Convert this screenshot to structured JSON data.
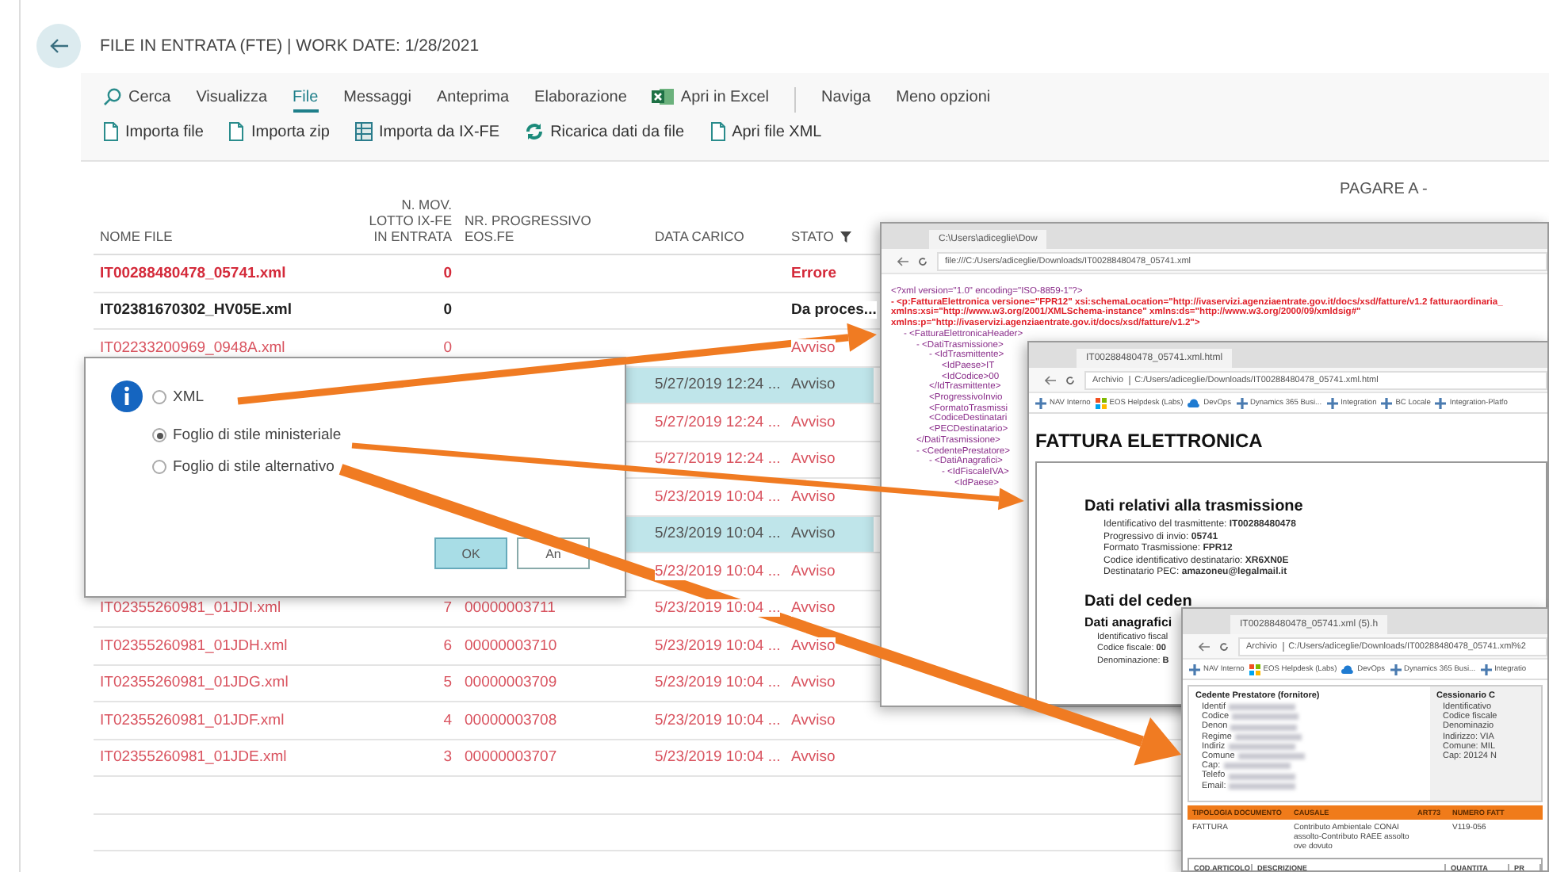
{
  "page": {
    "title": "FILE IN ENTRATA (FTE) | WORK DATE: 1/28/2021"
  },
  "menu": [
    {
      "label": "Cerca",
      "kind": "search",
      "selected": false
    },
    {
      "label": "Visualizza",
      "selected": false
    },
    {
      "label": "File",
      "selected": true
    },
    {
      "label": "Messaggi",
      "selected": false
    },
    {
      "label": "Anteprima",
      "selected": false
    },
    {
      "label": "Elaborazione",
      "selected": false
    },
    {
      "label": "Apri in Excel",
      "kind": "excel",
      "selected": false
    }
  ],
  "menu_more": [
    {
      "label": "Naviga",
      "selected": false
    },
    {
      "label": "Meno opzioni",
      "selected": false
    }
  ],
  "actions": [
    {
      "label": "Importa file",
      "kind": "document"
    },
    {
      "label": "Importa zip",
      "kind": "document"
    },
    {
      "label": "Importa da IX-FE",
      "kind": "table"
    },
    {
      "label": "Ricarica dati da file",
      "kind": "refresh"
    },
    {
      "label": "Apri file XML",
      "kind": "document"
    }
  ],
  "table": {
    "columns": [
      {
        "lines": [
          "NOME FILE"
        ]
      },
      {
        "lines": [
          "N. MOV.",
          "LOTTO IX-FE",
          "IN ENTRATA"
        ]
      },
      {
        "lines": [
          "NR. PROGRESSIVO",
          "EOS.FE"
        ]
      },
      {
        "lines": [
          "DATA CARICO"
        ]
      },
      {
        "lines": [
          "STATO"
        ],
        "filtered": true
      }
    ],
    "extra_column": "PAGARE A -",
    "rows": [
      {
        "name": "IT00288480478_05741.xml",
        "count": "0",
        "status": "Errore",
        "kind": "error",
        "selected": false
      },
      {
        "name": "IT02381670302_HV05E.xml",
        "count": "0",
        "status": "Da proces...",
        "kind": "pending",
        "selected": false
      },
      {
        "name": "IT02233200969_0948A.xml",
        "count": "0",
        "status": "Avviso",
        "kind": "warning",
        "selected": false
      },
      {
        "date": "5/27/2019 12:24 ...",
        "status": "Avviso",
        "kind": "warning",
        "selected": true
      },
      {
        "date": "5/27/2019 12:24 ...",
        "status": "Avviso",
        "kind": "warning",
        "selected": false
      },
      {
        "date": "5/27/2019 12:24 ...",
        "status": "Avviso",
        "kind": "warning",
        "selected": false
      },
      {
        "date": "5/23/2019 10:04 ...",
        "status": "Avviso",
        "kind": "warning",
        "selected": false
      },
      {
        "date": "5/23/2019 10:04 ...",
        "status": "Avviso",
        "kind": "warning",
        "selected": true
      },
      {
        "date": "5/23/2019 10:04 ...",
        "status": "Avviso",
        "kind": "warning",
        "selected": false
      },
      {
        "name": "IT02355260981_01JDI.xml",
        "count": "7",
        "progressive": "00000003711",
        "date": "5/23/2019 10:04 ...",
        "status": "Avviso",
        "kind": "warning",
        "selected": false
      },
      {
        "name": "IT02355260981_01JDH.xml",
        "count": "6",
        "progressive": "00000003710",
        "date": "5/23/2019 10:04 ...",
        "status": "Avviso",
        "kind": "warning",
        "selected": false
      },
      {
        "name": "IT02355260981_01JDG.xml",
        "count": "5",
        "progressive": "00000003709",
        "date": "5/23/2019 10:04 ...",
        "status": "Avviso",
        "kind": "warning",
        "selected": false
      },
      {
        "name": "IT02355260981_01JDF.xml",
        "count": "4",
        "progressive": "00000003708",
        "date": "5/23/2019 10:04 ...",
        "status": "Avviso",
        "kind": "warning",
        "selected": false
      },
      {
        "name": "IT02355260981_01JDE.xml",
        "count": "3",
        "progressive": "00000003707",
        "date": "5/23/2019 10:04 ...",
        "status": "Avviso",
        "kind": "warning",
        "selected": false
      }
    ]
  },
  "dialog": {
    "options": [
      {
        "label": "XML",
        "selected": false
      },
      {
        "label": "Foglio di stile ministeriale",
        "selected": true
      },
      {
        "label": "Foglio di stile alternativo",
        "selected": false
      }
    ],
    "buttons": [
      {
        "label": "OK",
        "kind": "primary"
      },
      {
        "label": "An",
        "kind": "secondary"
      }
    ]
  },
  "xml_viewer": {
    "tab": "C:\\Users\\adiceglie\\Dow",
    "address": "file:///C:/Users/adiceglie/Downloads/IT00288480478_05741.xml",
    "lines": [
      {
        "text": "<?xml version=\"1.0\" encoding=\"ISO-8859-1\"?>",
        "kind": "decl"
      },
      {
        "text": "- <p:FatturaElettronica versione=\"FPR12\" xsi:schemaLocation=\"http://ivaservizi.agenziaentrate.gov.it/docs/xsd/fatture/v1.2 fatturaordinaria_",
        "kind": "attr"
      },
      {
        "text": "xmlns:xsi=\"http://www.w3.org/2001/XMLSchema-instance\" xmlns:ds=\"http://www.w3.org/2000/09/xmldsig#\"",
        "kind": "attr"
      },
      {
        "text": "xmlns:p=\"http://ivaservizi.agenziaentrate.gov.it/docs/xsd/fatture/v1.2\">",
        "kind": "attr",
        "children": [
          {
            "text": "- <FatturaElettronicaHeader>",
            "kind": "tag",
            "children": [
              {
                "text": "- <DatiTrasmissione>",
                "kind": "tag",
                "children": [
                  {
                    "text": "- <IdTrasmittente>",
                    "kind": "tag",
                    "children": [
                      {
                        "text": "<IdPaese>IT",
                        "kind": "tag"
                      },
                      {
                        "text": "<IdCodice>00",
                        "kind": "tag"
                      }
                    ]
                  },
                  {
                    "text": "</IdTrasmittente>",
                    "kind": "tag"
                  },
                  {
                    "text": "<ProgressivoInvio",
                    "kind": "tag"
                  },
                  {
                    "text": "<FormatoTrasmissi",
                    "kind": "tag"
                  },
                  {
                    "text": "<CodiceDestinatari",
                    "kind": "tag"
                  },
                  {
                    "text": "<PECDestinatario>",
                    "kind": "tag"
                  }
                ]
              },
              {
                "text": "</DatiTrasmissione>",
                "kind": "tag"
              },
              {
                "text": "- <CedentePrestatore>",
                "kind": "tag",
                "children": [
                  {
                    "text": "- <DatiAnagrafici>",
                    "kind": "tag",
                    "children": [
                      {
                        "text": "- <IdFiscaleIVA>",
                        "kind": "tag",
                        "children": [
                          {
                            "text": "<IdPaese>",
                            "kind": "tag"
                          }
                        ]
                      }
                    ]
                  }
                ]
              }
            ]
          }
        ]
      }
    ]
  },
  "html_viewer": {
    "tab": "IT00288480478_05741.xml.html",
    "address_label": "Archivio",
    "address": "C:/Users/adiceglie/Downloads/IT00288480478_05741.xml.html",
    "bookmarks": [
      {
        "label": "NAV Interno",
        "kind": "plus"
      },
      {
        "label": "EOS Helpdesk (Labs)",
        "kind": "tiles"
      },
      {
        "label": "DevOps",
        "kind": "cloud"
      },
      {
        "label": "Dynamics 365 Busi...",
        "kind": "plus"
      },
      {
        "label": "Integration",
        "kind": "plus"
      },
      {
        "label": "BC Locale",
        "kind": "plus"
      },
      {
        "label": "Integration-Platfo",
        "kind": "plus"
      }
    ],
    "heading": "FATTURA ELETTRONICA",
    "section": "Dati relativi alla trasmissione",
    "fields": [
      "Identificativo del trasmittente: **IT00288480478**",
      "Progressivo di invio: **05741**",
      "Formato Trasmissione: **FPR12**",
      "Codice identificativo destinatario: **XR6XN0E**",
      "Destinatario PEC: **amazoneu@legalmail.it**"
    ],
    "section_2": "Dati del ceden",
    "subsection": "Dati anagrafici",
    "fields_2": [
      "Identificativo fiscal",
      "Codice fiscale: **00**",
      "Denominazione: **B**"
    ]
  },
  "invoice_viewer": {
    "tab": "IT00288480478_05741.xml (5).h",
    "address_label": "Archivio",
    "address": "C:/Users/adiceglie/Downloads/IT00288480478_05741.xml%2",
    "bookmarks": [
      {
        "label": "NAV Interno",
        "kind": "plus"
      },
      {
        "label": "EOS Helpdesk (Labs)",
        "kind": "tiles"
      },
      {
        "label": "DevOps",
        "kind": "cloud"
      },
      {
        "label": "Dynamics 365 Busi...",
        "kind": "plus"
      },
      {
        "label": "Integratio",
        "kind": "plus"
      }
    ],
    "supplier_title": "Cedente Prestatore (fornitore)",
    "supplier_labels": [
      "Identif",
      "Codice",
      "Denon",
      "Regime",
      "Indiriz",
      "Comune",
      "Cap:",
      "Telefo",
      "Email:"
    ],
    "customer_title": "Cessionario C",
    "customer_lines": [
      "Identificativo",
      "Codice fiscale",
      "Denominazio",
      "Indirizzo: VIA",
      "Comune: MIL",
      "Cap: 20124 N"
    ],
    "doc_columns": [
      "TIPOLOGIA DOCUMENTO",
      "CAUSALE",
      "ART73",
      "NUMERO FATT"
    ],
    "doc_row": {
      "type": "FATTURA",
      "reason": "Contributo Ambientale CONAI assolto-Contributo RAEE assolto ove dovuto",
      "number": "V119-056"
    },
    "item_columns": [
      "COD.ARTICOLO",
      "DESCRIZIONE",
      "QUANTITA",
      "PR"
    ]
  }
}
